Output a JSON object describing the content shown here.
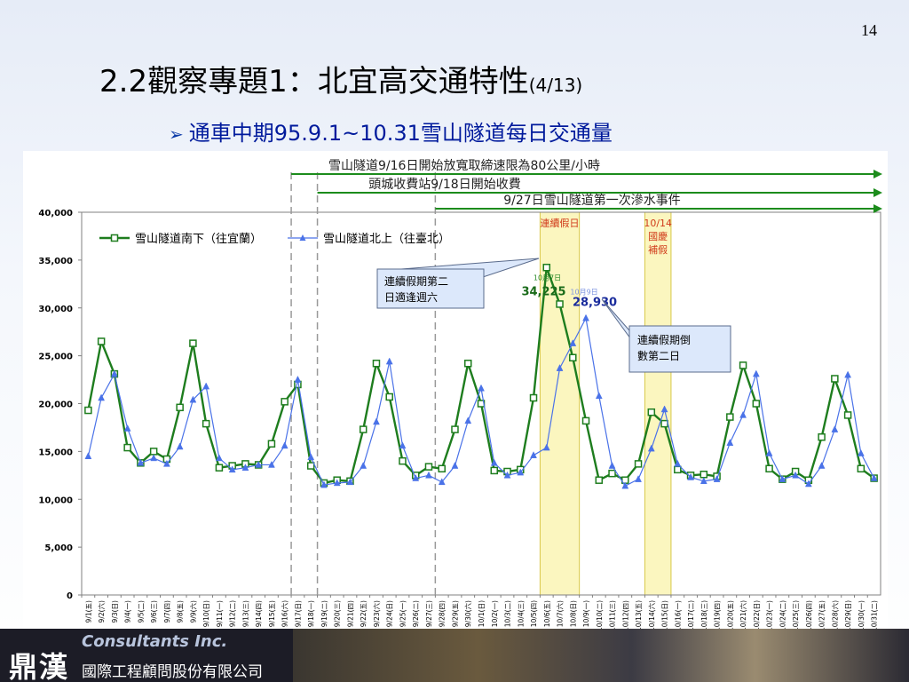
{
  "page_number": "14",
  "title": {
    "main": "2.2觀察專題1：北宜高交通特性",
    "sub": "(4/13)"
  },
  "subtitle": {
    "bullet": "➢",
    "text": "通車中期95.9.1~10.31雪山隧道每日交通量"
  },
  "footer": {
    "logo": "鼎漢",
    "banner": "Consultants Inc.",
    "company": "國際工程顧問股份有限公司"
  },
  "colors": {
    "south": "#1e7d1e",
    "north": "#4a72e8",
    "highlight_fill": "#fbf6bf",
    "highlight_stroke": "#d8c84a",
    "arrow": "#1c8c1c",
    "callout_fill": "#dce8fb",
    "callout_stroke": "#5a6b8c"
  },
  "chart_data": {
    "type": "line",
    "ylim": [
      0,
      40000
    ],
    "yticks": [
      "0",
      "5,000",
      "10,000",
      "15,000",
      "20,000",
      "25,000",
      "30,000",
      "35,000",
      "40,000"
    ],
    "x": [
      "9/1(五)",
      "9/2(六)",
      "9/3(日)",
      "9/4(一)",
      "9/5(二)",
      "9/6(三)",
      "9/7(四)",
      "9/8(五)",
      "9/9(六)",
      "9/10(日)",
      "9/11(一)",
      "9/12(二)",
      "9/13(三)",
      "9/14(四)",
      "9/15(五)",
      "9/16(六)",
      "9/17(日)",
      "9/18(一)",
      "9/19(二)",
      "9/20(三)",
      "9/21(四)",
      "9/22(五)",
      "9/23(六)",
      "9/24(日)",
      "9/25(一)",
      "9/26(二)",
      "9/27(三)",
      "9/28(四)",
      "9/29(五)",
      "9/30(六)",
      "10/1(日)",
      "10/2(一)",
      "10/3(二)",
      "10/4(三)",
      "10/5(四)",
      "10/6(五)",
      "10/7(六)",
      "10/8(日)",
      "10/9(一)",
      "10/10(二)",
      "10/11(三)",
      "10/12(四)",
      "10/13(五)",
      "10/14(六)",
      "10/15(日)",
      "10/16(一)",
      "10/17(二)",
      "10/18(三)",
      "10/19(四)",
      "10/20(五)",
      "10/21(六)",
      "10/22(日)",
      "10/23(一)",
      "10/24(二)",
      "10/25(三)",
      "10/26(四)",
      "10/27(五)",
      "10/28(六)",
      "10/29(日)",
      "10/30(一)",
      "10/31(二)"
    ],
    "series": [
      {
        "name": "雪山隧道南下（往宜蘭）",
        "marker": "square",
        "values": [
          19300,
          26500,
          23100,
          15400,
          13800,
          15000,
          14200,
          19600,
          26300,
          17900,
          13300,
          13500,
          13700,
          13600,
          15800,
          20200,
          22000,
          13500,
          11700,
          12000,
          11900,
          17300,
          24200,
          20700,
          14000,
          12500,
          13400,
          13200,
          17300,
          24200,
          20000,
          13000,
          12900,
          13100,
          20600,
          34225,
          30400,
          24800,
          18200,
          12000,
          12700,
          12000,
          13700,
          19100,
          17900,
          13100,
          12500,
          12600,
          12400,
          18600,
          24000,
          20000,
          13200,
          12100,
          12900,
          12000,
          16500,
          22600,
          18800,
          13200,
          12200
        ]
      },
      {
        "name": "雪山隧道北上（往臺北）",
        "marker": "triangle",
        "values": [
          14500,
          20600,
          23100,
          17400,
          13800,
          14300,
          13700,
          15500,
          20400,
          21800,
          14300,
          13100,
          13300,
          13600,
          13600,
          15600,
          22500,
          14400,
          11500,
          11700,
          11800,
          13500,
          18100,
          24400,
          15600,
          12200,
          12500,
          11800,
          13500,
          18200,
          21600,
          13800,
          12500,
          12800,
          14600,
          15400,
          23700,
          26300,
          28930,
          20800,
          13500,
          11400,
          12100,
          15300,
          19400,
          13700,
          12300,
          11900,
          12100,
          15900,
          18800,
          23100,
          14800,
          12100,
          12500,
          11600,
          13500,
          17300,
          23000,
          14800,
          12200
        ]
      }
    ],
    "highlights": [
      {
        "label": "連續假日",
        "from": "10/6(五)",
        "to": "10/8(日)"
      },
      {
        "label": "10/14\n國慶\n補假",
        "from": "10/14(六)",
        "to": "10/15(日)"
      }
    ],
    "events": [
      {
        "text": "雪山隧道9/16日開始放寬取締速限為80公里/小時",
        "from": "9/16(六)"
      },
      {
        "text": "頭城收費站9/18日開始收費",
        "from": "9/18(一)"
      },
      {
        "text": "9/27日雪山隧道第一次滲水事件",
        "from": "9/27(三)"
      }
    ],
    "annotations": [
      {
        "value": "34,225",
        "date_label": "10月7日",
        "date": "10/7(六)",
        "series": 0
      },
      {
        "value": "28,930",
        "date_label": "10月9日",
        "date": "10/9(一)",
        "series": 1
      }
    ],
    "callouts": [
      {
        "text": [
          "連續假期第二",
          "日適逢週六"
        ]
      },
      {
        "text": [
          "連續假期倒",
          "數第二日"
        ]
      }
    ]
  }
}
